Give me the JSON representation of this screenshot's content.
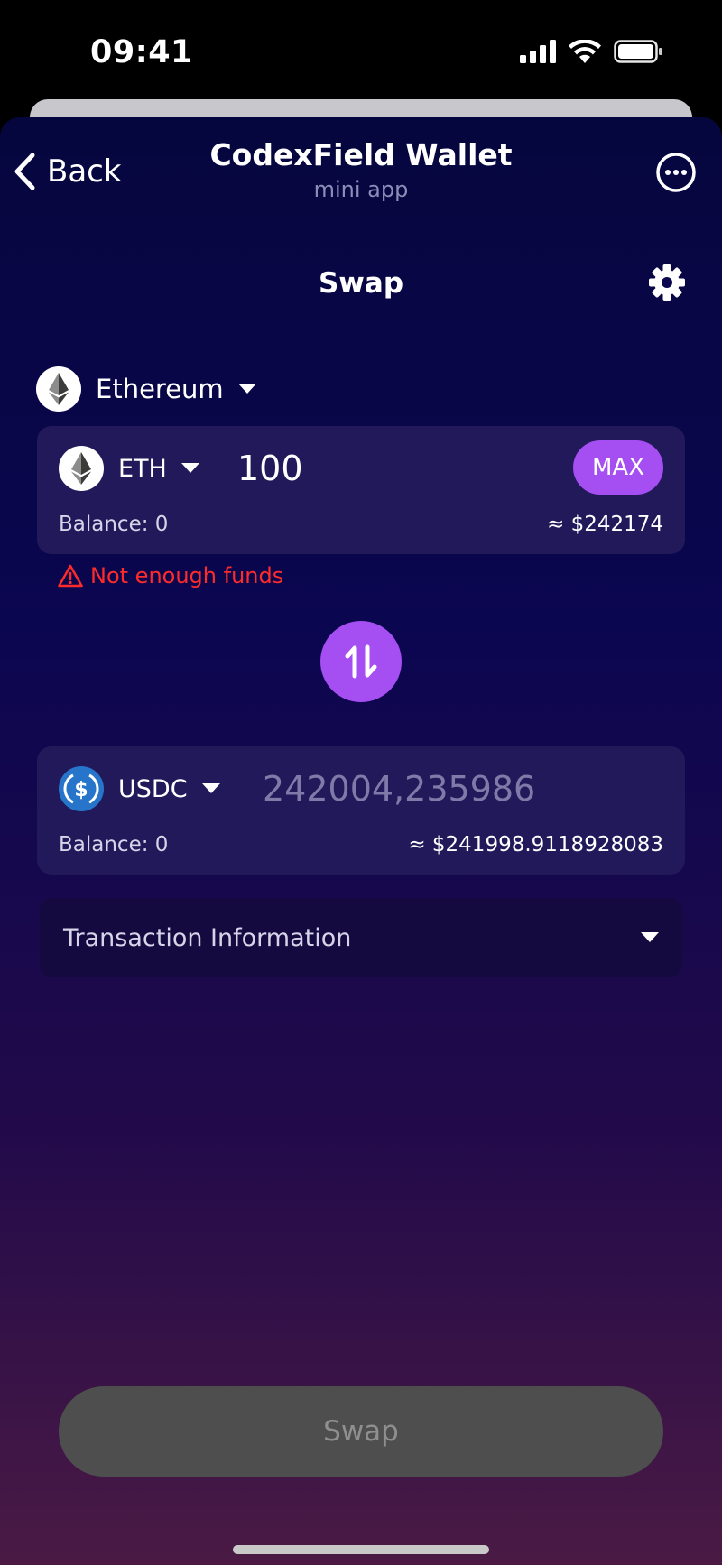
{
  "status_bar": {
    "time": "09:41",
    "icons": [
      "cellular-signal-icon",
      "wifi-icon",
      "battery-icon"
    ]
  },
  "header": {
    "back_label": "Back",
    "title": "CodexField Wallet",
    "subtitle": "mini app"
  },
  "page": {
    "title": "Swap"
  },
  "network": {
    "label": "Ethereum",
    "icon": "ethereum-icon"
  },
  "from": {
    "symbol": "ETH",
    "amount": "100",
    "max_label": "MAX",
    "balance": "Balance: 0",
    "fiat": "≈ $242174"
  },
  "error": {
    "message": "Not enough funds"
  },
  "to": {
    "symbol": "USDC",
    "amount_placeholder": "242004,235986",
    "balance": "Balance: 0",
    "fiat": "≈ $241998.9118928083"
  },
  "tx_info": {
    "label": "Transaction Information"
  },
  "actions": {
    "swap_label": "Swap"
  },
  "colors": {
    "accent": "#a54ef2",
    "error": "#ff2b2b",
    "card": "#21195a",
    "disabled_button": "#4e4e4e"
  }
}
